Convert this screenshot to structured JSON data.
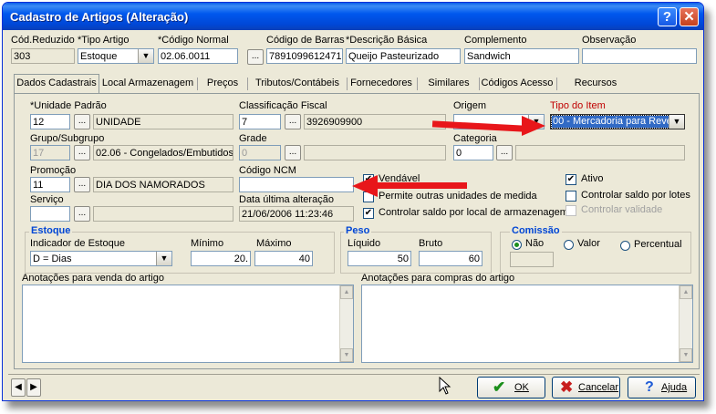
{
  "window": {
    "title": "Cadastro de Artigos (Alteração)",
    "help_label": "?",
    "close_label": "✕"
  },
  "header": {
    "cod_reduzido": {
      "label": "Cód.Reduzido",
      "value": "303"
    },
    "tipo_artigo": {
      "label": "*Tipo Artigo",
      "value": "Estoque"
    },
    "codigo_normal": {
      "label": "*Código Normal",
      "value": "02.06.0011"
    },
    "codigo_barras": {
      "label": "Código de Barras",
      "value": "7891099612471"
    },
    "descricao_basica": {
      "label": "*Descrição Básica",
      "value": "Queijo Pasteurizado"
    },
    "complemento": {
      "label": "Complemento",
      "value": "Sandwich"
    },
    "observacao": {
      "label": "Observação",
      "value": ""
    }
  },
  "tabs": [
    "Dados Cadastrais",
    "Local Armazenagem",
    "Preços",
    "Tributos/Contábeis",
    "Fornecedores",
    "Similares",
    "Códigos Acesso",
    "Recursos"
  ],
  "dados": {
    "unidade_padrao": {
      "label": "*Unidade Padrão",
      "code": "12",
      "desc": "UNIDADE"
    },
    "classificacao_fiscal": {
      "label": "Classificação Fiscal",
      "code": "7",
      "desc": "3926909900"
    },
    "origem": {
      "label": "Origem",
      "value": ""
    },
    "tipo_item": {
      "label": "Tipo do Item",
      "value": "00 - Mercadoria para Reve"
    },
    "grupo_subgrupo": {
      "label": "Grupo/Subgrupo",
      "code": "17",
      "desc": "02.06 - Congelados/Embutidos"
    },
    "grade": {
      "label": "Grade",
      "code": "0",
      "desc": ""
    },
    "categoria": {
      "label": "Categoria",
      "code": "0",
      "desc": ""
    },
    "promocao": {
      "label": "Promoção",
      "code": "11",
      "desc": "DIA DOS NAMORADOS"
    },
    "codigo_ncm": {
      "label": "Código NCM",
      "value": ""
    },
    "servico": {
      "label": "Serviço",
      "code": "",
      "desc": ""
    },
    "data_alteracao": {
      "label": "Data última alteração",
      "value": "21/06/2006 11:23:46"
    },
    "checkboxes": {
      "vendavel": {
        "label": "Vendável",
        "checked": true
      },
      "permite_unidades": {
        "label": "Permite outras unidades de medida",
        "checked": false
      },
      "controlar_local": {
        "label": "Controlar saldo por local de armazenagem",
        "checked": true
      },
      "ativo": {
        "label": "Ativo",
        "checked": true
      },
      "controlar_lotes": {
        "label": "Controlar saldo por lotes",
        "checked": false
      },
      "controlar_validade": {
        "label": "Controlar validade",
        "checked": false
      }
    },
    "lookup_label": "..."
  },
  "estoque": {
    "title": "Estoque",
    "indicador_label": "Indicador de Estoque",
    "indicador_value": "D = Dias",
    "minimo_label": "Mínimo",
    "minimo_value": "20.",
    "maximo_label": "Máximo",
    "maximo_value": "40"
  },
  "peso": {
    "title": "Peso",
    "liquido_label": "Líquido",
    "liquido_value": "50",
    "bruto_label": "Bruto",
    "bruto_value": "60"
  },
  "comissao": {
    "title": "Comissão",
    "options": [
      "Não",
      "Valor",
      "Percentual"
    ],
    "selected": "Não"
  },
  "anotacoes": {
    "venda_label": "Anotações para venda do artigo",
    "compras_label": "Anotações para compras do artigo"
  },
  "footer": {
    "ok_label": "OK",
    "cancel_label": "Cancelar",
    "help_label": "Ajuda"
  },
  "colors": {
    "titlebar": "#0058ee",
    "group_title": "#0046d5",
    "required_red": "#c00000",
    "annotation_arrow": "#e8161a"
  }
}
